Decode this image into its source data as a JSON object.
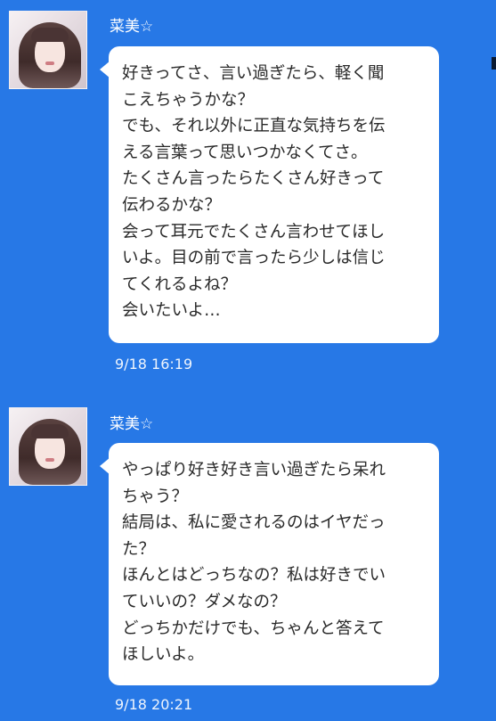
{
  "messages": [
    {
      "sender": "菜美☆",
      "lines": [
        "好きってさ、言い過ぎたら、軽く聞",
        "こえちゃうかな？",
        "でも、それ以外に正直な気持ちを伝",
        "える言葉って思いつかなくてさ。",
        "たくさん言ったらたくさん好きって",
        "伝わるかな？",
        "会って耳元でたくさん言わせてほし",
        "いよ。目の前で言ったら少しは信じ",
        "てくれるよね？",
        "会いたいよ…"
      ],
      "timestamp": "9/18 16:19"
    },
    {
      "sender": "菜美☆",
      "lines": [
        "やっぱり好き好き言い過ぎたら呆れ",
        "ちゃう？",
        "結局は、私に愛されるのはイヤだっ",
        "た？",
        "ほんとはどっちなの？私は好きでい",
        "ていいの？ダメなの？",
        "どっちかだけでも、ちゃんと答えて",
        "ほしいよ。"
      ],
      "timestamp": "9/18 20:21"
    }
  ]
}
